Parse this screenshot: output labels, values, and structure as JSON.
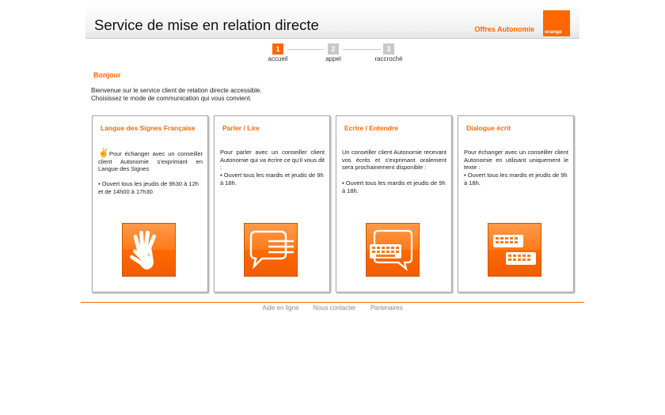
{
  "header": {
    "title": "Service de mise en relation directe",
    "offres_label": "Offres Autonomie",
    "logo_text": "orange",
    "brand_color": "#ff6600"
  },
  "steps": [
    {
      "num": "1",
      "label": "accueil",
      "active": true
    },
    {
      "num": "2",
      "label": "appel",
      "active": false
    },
    {
      "num": "3",
      "label": "raccroché",
      "active": false
    }
  ],
  "greeting": "Bonjour",
  "intro": [
    "Bienvenue sur le service client de relation directe accessible.",
    "Choisissez le mode de communication qui vous convient."
  ],
  "cards": [
    {
      "title": "Langue des Signes Française",
      "desc": "Pour échanger avec un conseiller client Autonomie s'exprimant en Langue des Signes",
      "hours": "Ouvert tous les jeudis de 9h30 à 12h et de 14h00 à 17h30.",
      "icon": "sign-language-hands-icon"
    },
    {
      "title": "Parler / Lire",
      "desc": "Pour parler avec un conseiller client Autonomie qui va écrire ce qu'il vous dit :",
      "hours": "Ouvert tous les mardis et jeudis de 9h à 18h.",
      "icon": "speech-bubble-text-icon"
    },
    {
      "title": "Ecrire / Entendre",
      "desc": "Un conseiller client Autonomie recevant vos écrits et s'exprimant oralement sera prochainement disponible :",
      "hours": "Ouvert tous les mardis et jeudis de 9h à 18h.",
      "icon": "speech-bubble-keyboard-icon"
    },
    {
      "title": "Dialogue écrit",
      "desc": "Pour échanger avec un conseiller client Autonomie en utilisant uniquement le texte :",
      "hours": "Ouvert tous les mardis et jeudis de 9h à 18h.",
      "icon": "two-keyboards-icon"
    }
  ],
  "footer": {
    "links": [
      "Aide en ligne",
      "Nous contacter",
      "Partenaires"
    ]
  }
}
